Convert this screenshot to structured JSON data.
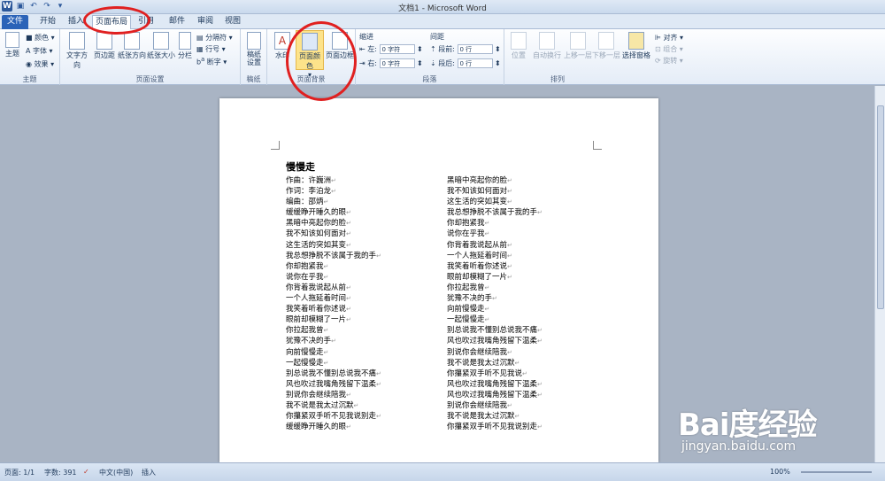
{
  "window": {
    "title": "文档1 - Microsoft Word"
  },
  "tabs": [
    "文件",
    "开始",
    "插入",
    "页面布局",
    "引用",
    "邮件",
    "审阅",
    "视图"
  ],
  "ribbon": {
    "themes": {
      "main": "主题",
      "colors": "颜色",
      "fonts": "字体",
      "effects": "效果",
      "label": "主题"
    },
    "page_setup": {
      "text_dir": "文字方向",
      "margins": "页边距",
      "orientation": "纸张方向",
      "size": "纸张大小",
      "columns": "分栏",
      "breaks": "分隔符",
      "line_numbers": "行号",
      "hyphen": "断字",
      "label": "页面设置"
    },
    "draft": {
      "btn": "稿纸\n设置",
      "label": "稿纸"
    },
    "background": {
      "watermark": "水印",
      "page_color": "页面颜色",
      "page_border": "页面边框",
      "label": "页面背景"
    },
    "paragraph": {
      "indent": "缩进",
      "spacing": "间距",
      "left": "左:",
      "right": "右:",
      "before": "段前:",
      "after": "段后:",
      "indent_left_val": "0 字符",
      "indent_right_val": "0 字符",
      "before_val": "0 行",
      "after_val": "0 行",
      "label": "段落"
    },
    "arrange": {
      "position": "位置",
      "wrap": "自动换行",
      "forward": "上移一层",
      "backward": "下移一层",
      "selection": "选择窗格",
      "align": "对齐",
      "group": "组合",
      "rotate": "旋转",
      "label": "排列"
    }
  },
  "document": {
    "title": "慢慢走",
    "left_column": [
      "作曲：许巍洲",
      "作词：李泊龙",
      "编曲：邵炳",
      "缓缓睁开睡久的眼",
      "黑暗中亮起你的脸",
      "我不知该如何面对",
      "这生活的突如其变",
      "我总想挣脱不该属于我的手",
      "你却抱紧我",
      "说你在乎我",
      "你背着我说起从前",
      "一个人拖延着时间",
      "我笑着听着你述说",
      "眼前却模糊了一片",
      "你拉起我曾",
      "犹豫不决的手",
      "向前慢慢走",
      "一起慢慢走",
      "别总说我不懂别总说我不痛",
      "风也吹过我嘴角残留下温柔",
      "别说你会继续陪我",
      "我不说是我太过沉默",
      "你攥紧双手听不见我说别走",
      "缓缓睁开睡久的眼"
    ],
    "right_column": [
      "黑暗中亮起你的脸",
      "我不知该如何面对",
      "这生活的突如其变",
      "我总想挣脱不该属于我的手",
      "你却抱紧我",
      "说你在乎我",
      "你背着我说起从前",
      "一个人拖延着时间",
      "我笑着听着你述说",
      "眼前却模糊了一片",
      "你拉起我曾",
      "犹豫不决的手",
      "向前慢慢走",
      "一起慢慢走",
      "别总说我不懂别总说我不痛",
      "风也吹过我嘴角残留下温柔",
      "别说你会继续陪我",
      "我不说是我太过沉默",
      "你攥紧双手听不见我说",
      "风也吹过我嘴角残留下温柔",
      "风也吹过我嘴角残留下温柔",
      "别说你会继续陪我",
      "我不说是我太过沉默",
      "你攥紧双手听不见我说别走"
    ]
  },
  "status": {
    "page": "页面: 1/1",
    "words": "字数: 391",
    "lang": "中文(中国)",
    "mode": "插入",
    "zoom": "100%"
  },
  "watermark": {
    "brand": "Bai度经验",
    "url": "jingyan.baidu.com"
  }
}
